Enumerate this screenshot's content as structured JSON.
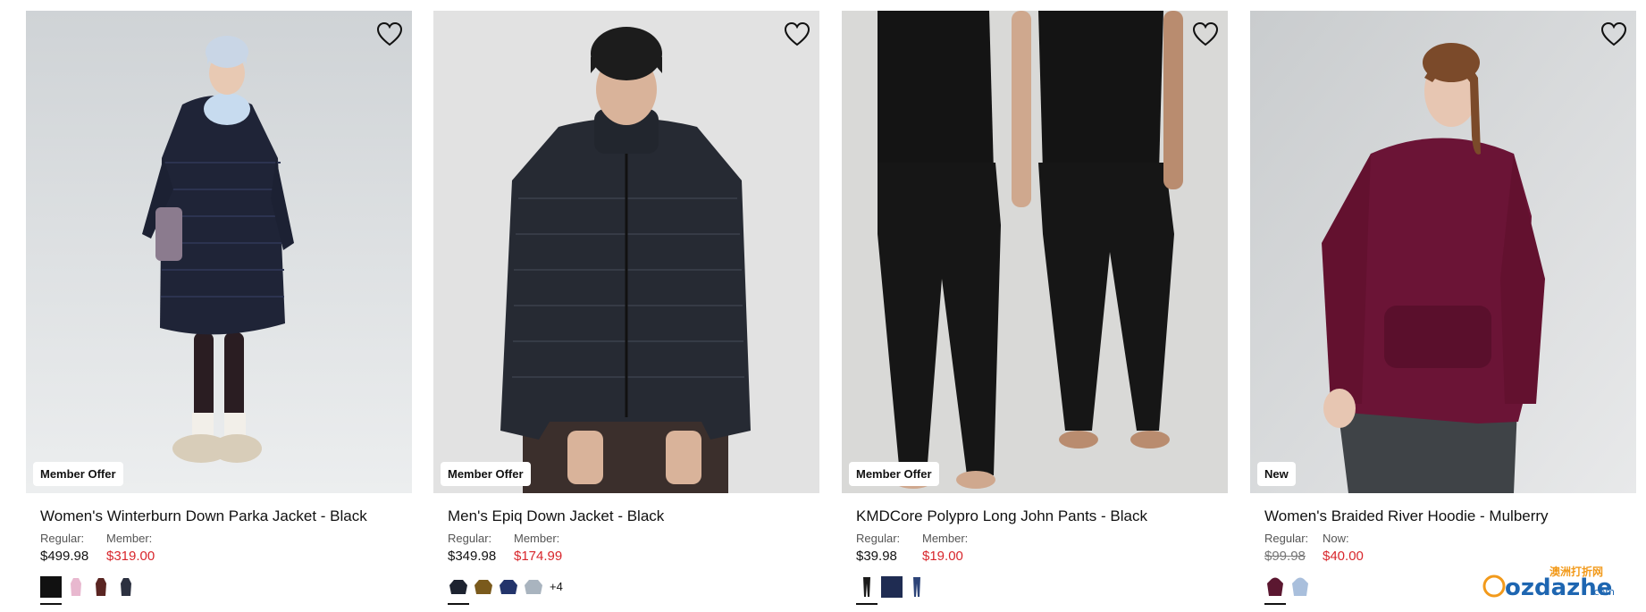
{
  "products": [
    {
      "image_alt": "Women's Winterburn Down Parka Jacket",
      "badge": "Member Offer",
      "title": "Women's Winterburn Down Parka Jacket - Black",
      "price_left_label": "Regular:",
      "price_left_value": "$499.98",
      "price_right_label": "Member:",
      "price_right_value": "$319.00",
      "swatches": [
        "#111111",
        "#e8b8cf",
        "#5a2522",
        "#2c3140"
      ],
      "more_colors": ""
    },
    {
      "image_alt": "Men's Epiq Down Jacket",
      "badge": "Member Offer",
      "title": "Men's Epiq Down Jacket - Black",
      "price_left_label": "Regular:",
      "price_left_value": "$349.98",
      "price_right_label": "Member:",
      "price_right_value": "$174.99",
      "swatches": [
        "#1d2330",
        "#7a5a1c",
        "#23346b",
        "#a9b4bf"
      ],
      "more_colors": "+4"
    },
    {
      "image_alt": "KMDCore Polypro Long John Pants",
      "badge": "Member Offer",
      "title": "KMDCore Polypro Long John Pants - Black",
      "price_left_label": "Regular:",
      "price_left_value": "$39.98",
      "price_right_label": "Member:",
      "price_right_value": "$19.00",
      "swatches": [
        "#1a1a1a",
        "#1f2c52",
        "#2c4377"
      ],
      "more_colors": ""
    },
    {
      "image_alt": "Women's Braided River Hoodie",
      "badge": "New",
      "title": "Women's Braided River Hoodie - Mulberry",
      "price_left_label": "Regular:",
      "price_left_value": "$99.98",
      "price_right_label": "Now:",
      "price_right_value": "$40.00",
      "swatches": [
        "#5b1730",
        "#a9bfdc"
      ],
      "more_colors": ""
    }
  ],
  "colors": {
    "sale": "#d8262c",
    "badge_bg": "#ffffff",
    "text": "#111111"
  },
  "watermark": {
    "brand": "ozdazhe",
    "suffix": ".com",
    "cn": "澳洲打折网"
  }
}
